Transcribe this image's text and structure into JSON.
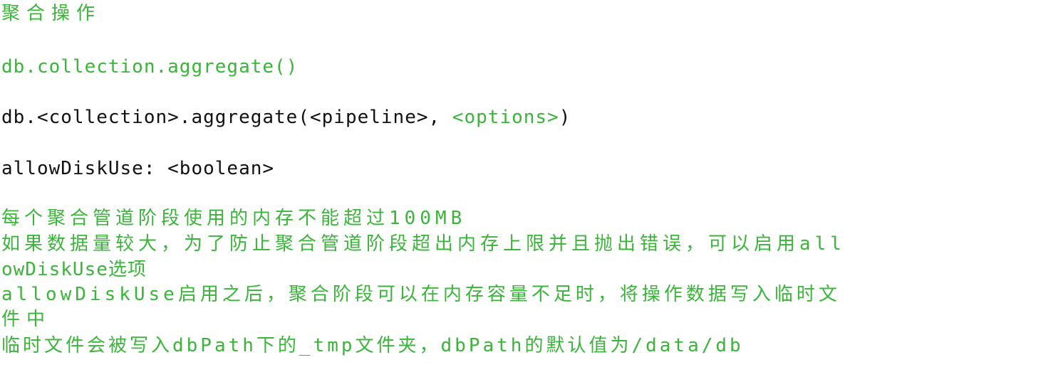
{
  "heading": "聚合操作",
  "signature_simple": "db.collection.aggregate()",
  "signature_full": {
    "prefix": "db.<collection>.aggregate(<pipeline>, ",
    "options": "<options>",
    "suffix": ")"
  },
  "option_line": "allowDiskUse: <boolean>",
  "notes": [
    "每个聚合管道阶段使用的内存不能超过100MB",
    "如果数据量较大，为了防止聚合管道阶段超出内存上限并且抛出错误，可以启用all",
    "owDiskUse选项",
    "allowDiskUse启用之后，聚合阶段可以在内存容量不足时，将操作数据写入临时文",
    "件中",
    "临时文件会被写入dbPath下的_tmp文件夹，dbPath的默认值为/data/db"
  ],
  "colors": {
    "green": "#3ab53a",
    "black": "#111111"
  }
}
